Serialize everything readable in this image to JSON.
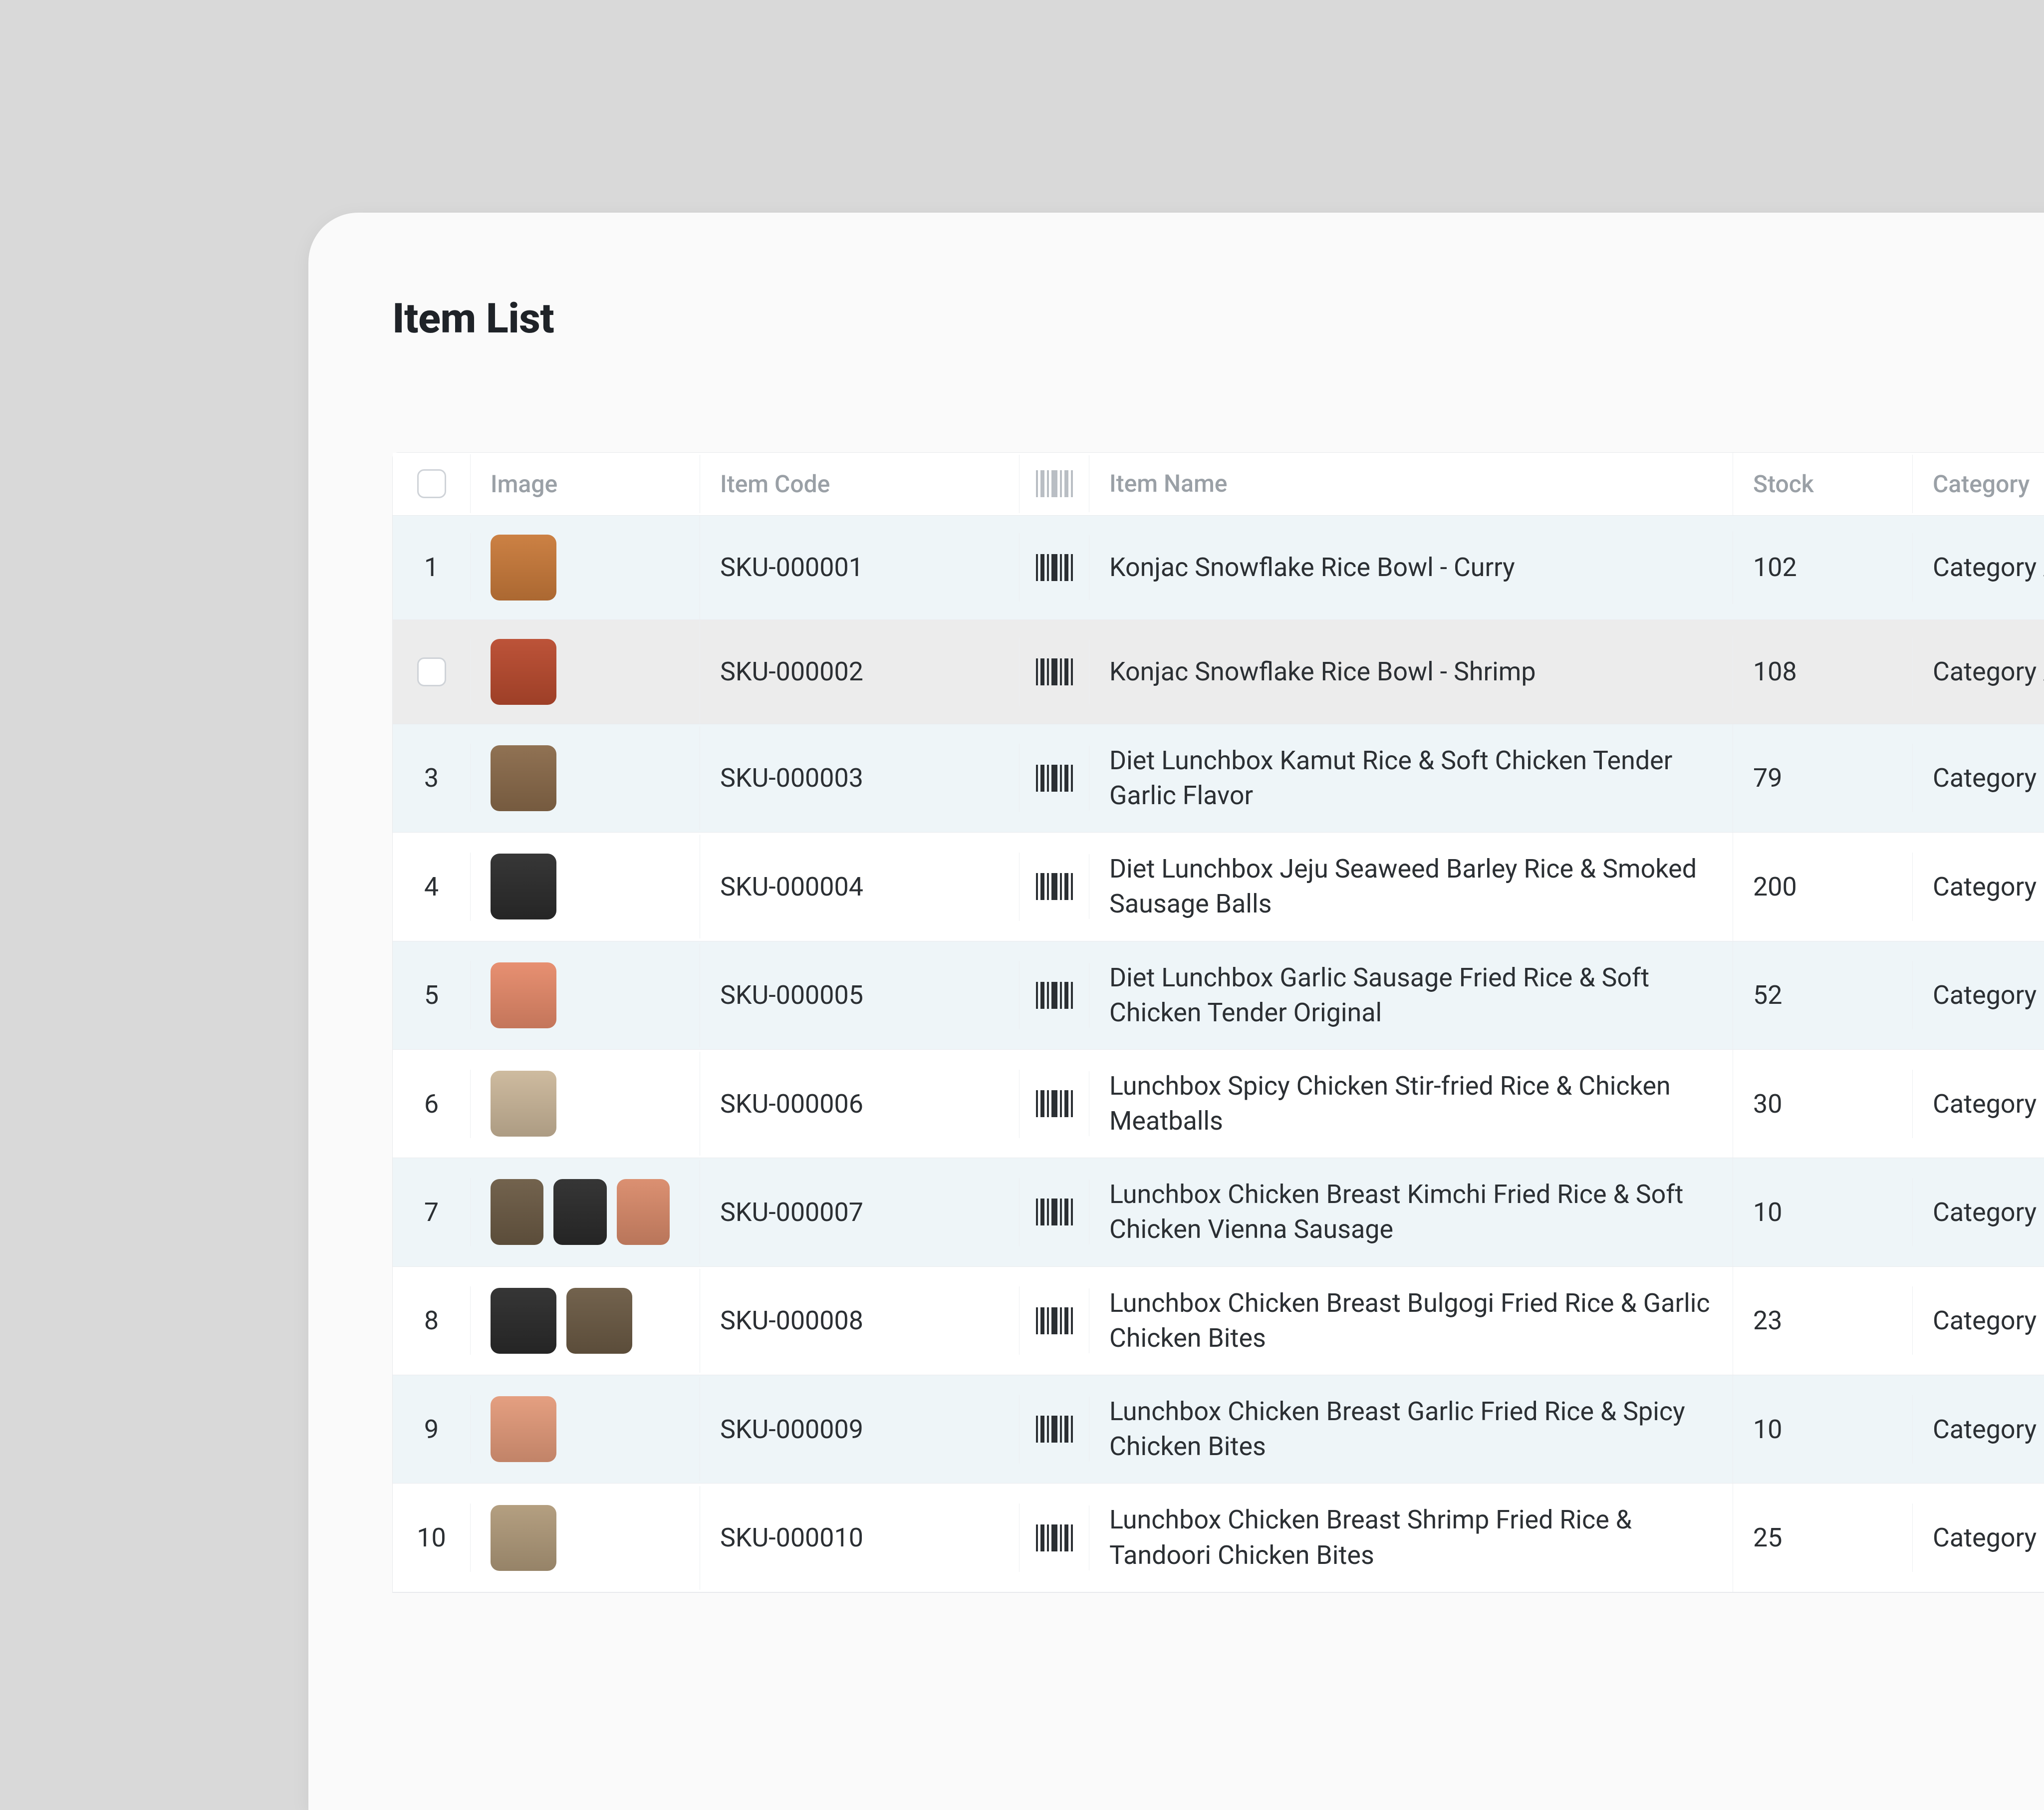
{
  "title": "Item List",
  "columns": {
    "image": "Image",
    "item_code": "Item Code",
    "item_name": "Item Name",
    "stock": "Stock",
    "category": "Category"
  },
  "rows": [
    {
      "idx": "1",
      "code": "SKU-000001",
      "name": "Konjac Snowflake Rice Bowl - Curry",
      "stock": "102",
      "category": "Category A",
      "thumbs": [
        "#c97a3a"
      ]
    },
    {
      "idx": "",
      "code": "SKU-000002",
      "name": "Konjac Snowflake Rice Bowl - Shrimp",
      "stock": "108",
      "category": "Category A",
      "thumbs": [
        "#b94a2e"
      ],
      "hover": true
    },
    {
      "idx": "3",
      "code": "SKU-000003",
      "name": "Diet Lunchbox Kamut Rice & Soft Chicken Tender Garlic Flavor",
      "stock": "79",
      "category": "Category B",
      "thumbs": [
        "#8a6a4a"
      ]
    },
    {
      "idx": "4",
      "code": "SKU-000004",
      "name": "Diet Lunchbox Jeju Seaweed Barley Rice & Smoked Sausage Balls",
      "stock": "200",
      "category": "Category B",
      "thumbs": [
        "#2c2c2c"
      ]
    },
    {
      "idx": "5",
      "code": "SKU-000005",
      "name": "Diet Lunchbox Garlic Sausage Fried Rice & Soft Chicken Tender Original",
      "stock": "52",
      "category": "Category B",
      "thumbs": [
        "#e68a6a"
      ]
    },
    {
      "idx": "6",
      "code": "SKU-000006",
      "name": "Lunchbox Spicy Chicken Stir-fried Rice & Chicken Meatballs",
      "stock": "30",
      "category": "Category C",
      "thumbs": [
        "#cbb79a"
      ]
    },
    {
      "idx": "7",
      "code": "SKU-000007",
      "name": "Lunchbox Chicken Breast Kimchi Fried Rice & Soft Chicken Vienna Sausage",
      "stock": "10",
      "category": "Category C",
      "thumbs": [
        "#6b5a44",
        "#2b2b2b",
        "#d98a6a"
      ]
    },
    {
      "idx": "8",
      "code": "SKU-000008",
      "name": "Lunchbox Chicken Breast Bulgogi Fried Rice & Garlic Chicken Bites",
      "stock": "23",
      "category": "Category C",
      "thumbs": [
        "#2b2b2b",
        "#6b5a44"
      ]
    },
    {
      "idx": "9",
      "code": "SKU-000009",
      "name": "Lunchbox Chicken Breast Garlic Fried Rice & Spicy Chicken Bites",
      "stock": "10",
      "category": "Category C",
      "thumbs": [
        "#e39a7a"
      ]
    },
    {
      "idx": "10",
      "code": "SKU-000010",
      "name": "Lunchbox Chicken Breast Shrimp Fried Rice & Tandoori Chicken Bites",
      "stock": "25",
      "category": "Category C",
      "thumbs": [
        "#b09a7a"
      ]
    }
  ]
}
